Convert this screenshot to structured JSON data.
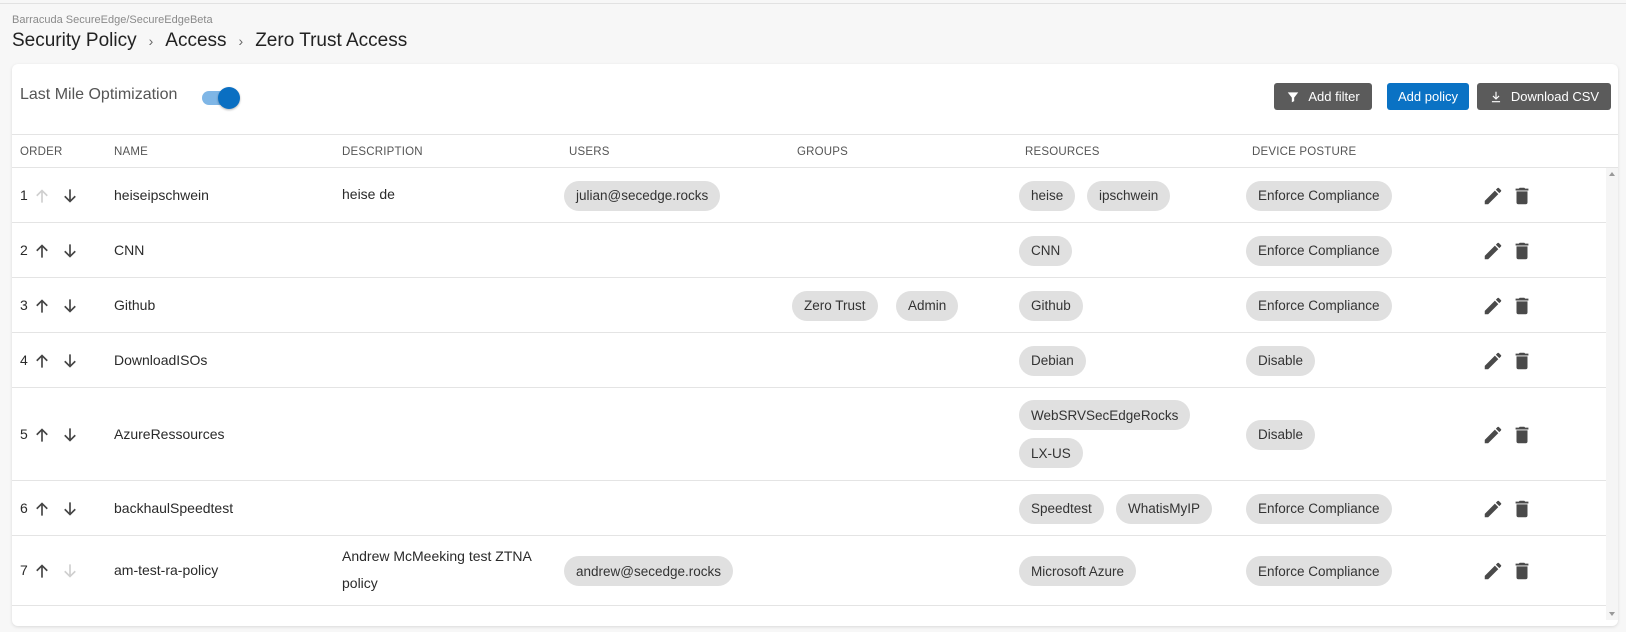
{
  "header": {
    "path": "Barracuda SecureEdge/SecureEdgeBeta",
    "breadcrumb": [
      "Security Policy",
      "Access",
      "Zero Trust Access"
    ]
  },
  "toolbar": {
    "lmo_label": "Last Mile Optimization",
    "lmo_enabled": true,
    "filter_label": "Add filter",
    "add_label": "Add policy",
    "csv_label": "Download CSV"
  },
  "columns": [
    "ORDER",
    "NAME",
    "DESCRIPTION",
    "USERS",
    "GROUPS",
    "RESOURCES",
    "DEVICE POSTURE"
  ],
  "rows": [
    {
      "order": "1",
      "name": "heiseipschwein",
      "description": [
        "heise de"
      ],
      "users": [
        "julian@secedge.rocks"
      ],
      "groups": [],
      "resources": [
        "heise",
        "ipschwein"
      ],
      "posture": "Enforce Compliance",
      "up_disabled": true,
      "down_disabled": false
    },
    {
      "order": "2",
      "name": "CNN",
      "description": [],
      "users": [],
      "groups": [],
      "resources": [
        "CNN"
      ],
      "posture": "Enforce Compliance",
      "up_disabled": false,
      "down_disabled": false
    },
    {
      "order": "3",
      "name": "Github",
      "description": [],
      "users": [],
      "groups": [
        "Zero Trust",
        "Admin"
      ],
      "resources": [
        "Github"
      ],
      "posture": "Enforce Compliance",
      "up_disabled": false,
      "down_disabled": false
    },
    {
      "order": "4",
      "name": "DownloadISOs",
      "description": [],
      "users": [],
      "groups": [],
      "resources": [
        "Debian"
      ],
      "posture": "Disable",
      "up_disabled": false,
      "down_disabled": false
    },
    {
      "order": "5",
      "name": "AzureRessources",
      "description": [],
      "users": [],
      "groups": [],
      "resources": [
        "WebSRVSecEdgeRocks",
        "LX-US"
      ],
      "posture": "Disable",
      "up_disabled": false,
      "down_disabled": false
    },
    {
      "order": "6",
      "name": "backhaulSpeedtest",
      "description": [],
      "users": [],
      "groups": [],
      "resources": [
        "Speedtest",
        "WhatisMyIP"
      ],
      "posture": "Enforce Compliance",
      "up_disabled": false,
      "down_disabled": false
    },
    {
      "order": "7",
      "name": "am-test-ra-policy",
      "description": [
        "Andrew McMeeking test ZTNA",
        "policy"
      ],
      "users": [
        "andrew@secedge.rocks"
      ],
      "groups": [],
      "resources": [
        "Microsoft Azure"
      ],
      "posture": "Enforce Compliance",
      "up_disabled": false,
      "down_disabled": true
    }
  ],
  "colors": {
    "accent": "#0a72c4",
    "dark_button": "#5b5b5b",
    "chip": "#e0e0e0",
    "toggle_track": "#7fb6e6",
    "toggle_knob": "#0a6fc2"
  },
  "icons": {
    "filter": "filter-icon",
    "download": "download-icon",
    "up": "arrow-up-icon",
    "down": "arrow-down-icon",
    "edit": "pencil-icon",
    "delete": "trash-icon"
  }
}
